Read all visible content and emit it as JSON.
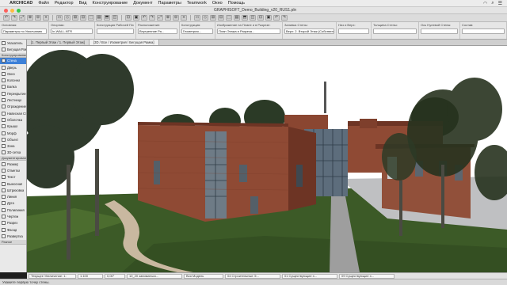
{
  "menubar": {
    "app_name": "ARCHICAD",
    "items": [
      "Файл",
      "Редактор",
      "Вид",
      "Конструирование",
      "Документ",
      "Параметры",
      "Teamwork",
      "Окно",
      "Помощь"
    ]
  },
  "window": {
    "title": "GRAPHISOFT_Demo_Building_v20_RUS1.pln"
  },
  "toolbar": {
    "button_count": 34
  },
  "infobox": {
    "cells": [
      {
        "label": "Основная:",
        "value": "Параметры по Умолчанию"
      },
      {
        "label": "Опорная:",
        "value": "In-WALL-NTR"
      },
      {
        "label": "Конструкция Рабочей Плоскости:",
        "value": ""
      },
      {
        "label": "Расположение:",
        "value": "Внутренние Ра..."
      },
      {
        "label": "Конструкция:",
        "value": "Геометрия..."
      },
      {
        "label": "Изображение на Плане и в Разрезе:",
        "value": "План Этажа и Разреза..."
      },
      {
        "label": "Заливка Стены:",
        "value": "Верх: 2. Второй Этаж (Собственны..."
      },
      {
        "label": "Низ и Верх:",
        "value": ""
      },
      {
        "label": "Толщина Стены:",
        "value": ""
      },
      {
        "label": "Ось Нулевой Стены:",
        "value": ""
      },
      {
        "label": "Состав:",
        "value": ""
      }
    ]
  },
  "toolbox": {
    "header_design": "Конструирование",
    "header_document": "Документирование",
    "items_top": [
      "Указатель",
      "Бегущая Рамка"
    ],
    "design_items": [
      "Стена",
      "Дверь",
      "Окно",
      "Колонна",
      "Балка",
      "Перекрытие",
      "Лестница",
      "Ограждение",
      "Навесная Стена",
      "Оболочка",
      "Крыша",
      "Морф",
      "Объект",
      "Зона",
      "3D-сетка"
    ],
    "document_items": [
      "Размер",
      "Отметка",
      "Текст",
      "Выносная",
      "Штриховка",
      "Линия",
      "Дуга",
      "Полилиния",
      "Чертеж",
      "Разрез",
      "Фасад",
      "Развертка"
    ],
    "selected": "Стена",
    "more_label": "Разное"
  },
  "tabs": {
    "items": [
      "[1. Первый Этаж / 1. Первый Этаж]",
      "[3D / Все / Изометрия / Бегущая Рамка]"
    ],
    "active_index": 1
  },
  "statusbar": {
    "fields": [
      "Текущее Увеличение: 1:",
      "1:100",
      "0,00°",
      "10_20 заниматься...",
      "Вся Модель",
      "04 Строительные Э...",
      "01 Существующие э...",
      "09 Существующие э..."
    ]
  },
  "hint": "Укажите первую точку стены.",
  "colors": {
    "accent": "#3d80d8",
    "brick": "#8f4a34",
    "brick_dark": "#6d3424",
    "grass": "#3c5a27",
    "sky": "#ffffff",
    "path": "#a8a8a8"
  }
}
